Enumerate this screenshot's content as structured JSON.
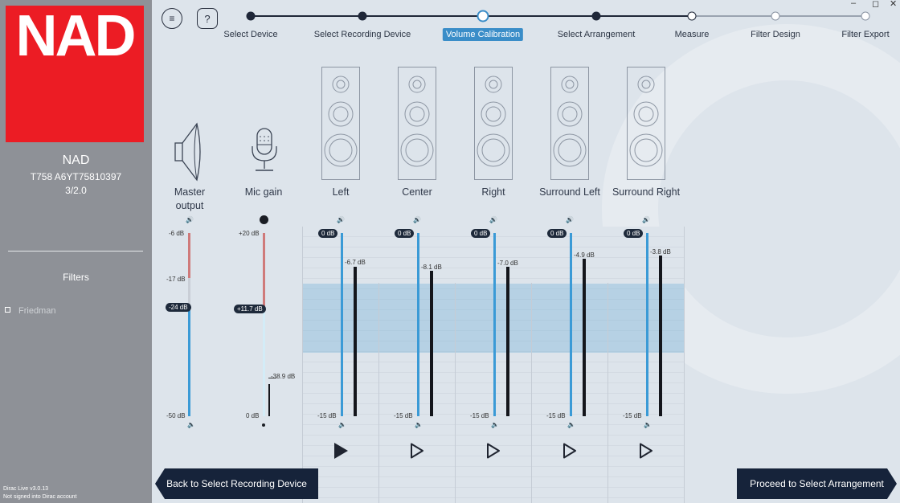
{
  "window": {
    "controls": [
      "–",
      "◻",
      "✕"
    ]
  },
  "sidebar": {
    "logo": "NAD",
    "device_name": "NAD",
    "device_model": "T758 A6YT75810397",
    "device_version": "3/2.0",
    "filters_heading": "Filters",
    "filter_item": "Friedman",
    "app_version": "Dirac Live v3.0.13",
    "account_status": "Not signed into Dirac account"
  },
  "toolbar": {
    "menu_icon": "≡",
    "help_icon": "?"
  },
  "steps": [
    {
      "label": "Select Device",
      "state": "done"
    },
    {
      "label": "Select Recording Device",
      "state": "done"
    },
    {
      "label": "Volume Calibration",
      "state": "current"
    },
    {
      "label": "Select Arrangement",
      "state": "done"
    },
    {
      "label": "Measure",
      "state": "pending"
    },
    {
      "label": "Filter Design",
      "state": "pending"
    },
    {
      "label": "Filter Export",
      "state": "pending"
    }
  ],
  "master": {
    "label_line1": "Master",
    "label_line2": "output",
    "top": "-6 dB",
    "mid": "-17 dB",
    "value": "-24 dB",
    "bottom": "-50 dB"
  },
  "mic": {
    "label": "Mic gain",
    "top": "+20 dB",
    "value": "+11.7 dB",
    "level": "-38.9 dB",
    "bottom": "0 dB"
  },
  "channels": [
    {
      "name": "Left",
      "gain": "0 dB",
      "level": "-6.7 dB",
      "bottom": "-15 dB"
    },
    {
      "name": "Center",
      "gain": "0 dB",
      "level": "-8.1 dB",
      "bottom": "-15 dB"
    },
    {
      "name": "Right",
      "gain": "0 dB",
      "level": "-7.0 dB",
      "bottom": "-15 dB"
    },
    {
      "name": "Surround Left",
      "gain": "0 dB",
      "level": "-4.9 dB",
      "bottom": "-15 dB"
    },
    {
      "name": "Surround Right",
      "gain": "0 dB",
      "level": "-3.8 dB",
      "bottom": "-15 dB"
    }
  ],
  "nav": {
    "back": "Back to Select Recording Device",
    "next": "Proceed to Select Arrangement"
  },
  "colors": {
    "brand_red": "#ec1c24",
    "accent_blue": "#3a8dc8",
    "dark_navy": "#16233a",
    "sidebar_gray": "#8e9197"
  }
}
